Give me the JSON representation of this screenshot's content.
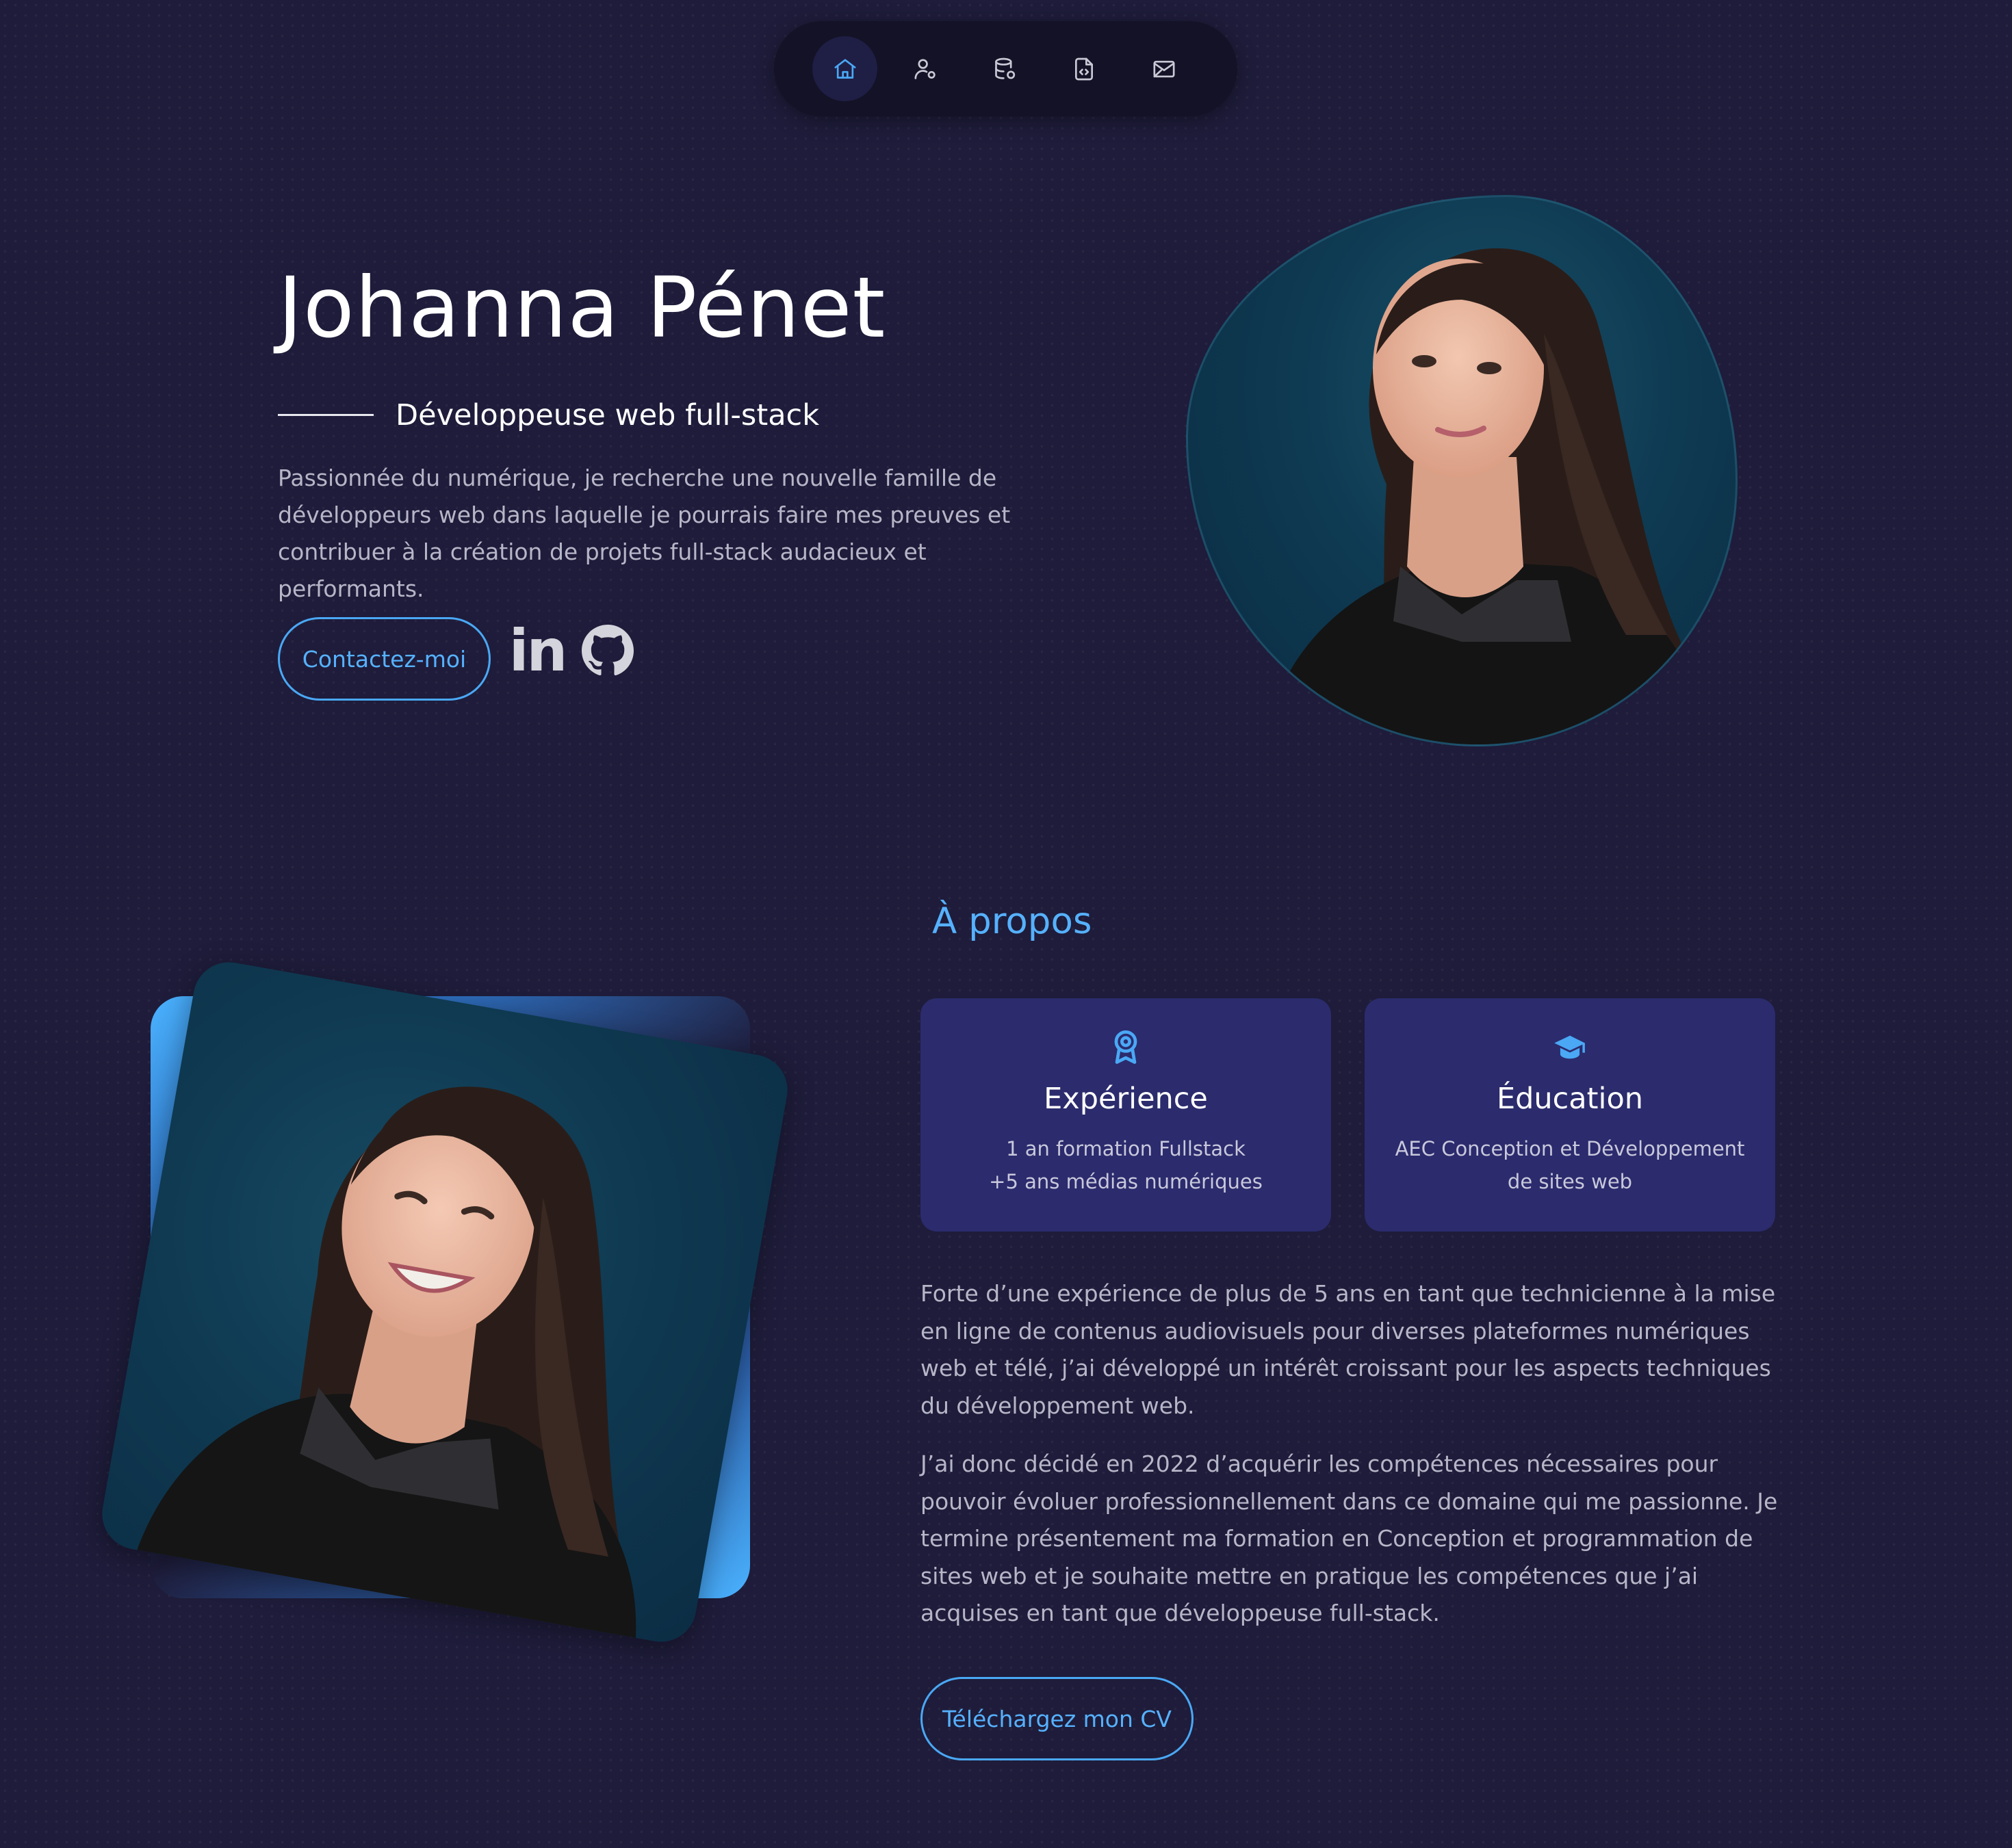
{
  "nav": {
    "items": [
      {
        "icon": "home-icon",
        "active": true
      },
      {
        "icon": "user-icon",
        "active": false
      },
      {
        "icon": "database-icon",
        "active": false
      },
      {
        "icon": "code-file-icon",
        "active": false
      },
      {
        "icon": "mail-icon",
        "active": false
      }
    ]
  },
  "hero": {
    "name": "Johanna Pénet",
    "subtitle": "Développeuse web full-stack",
    "description": "Passionnée du numérique, je recherche une nouvelle famille de développeurs web dans laquelle je pourrais faire mes preuves et contribuer à la création de projets full-stack audacieux et performants.",
    "contact_button": "Contactez-moi",
    "linkedin_label": "in",
    "social_icons": [
      "linkedin-icon",
      "github-icon"
    ]
  },
  "about": {
    "title": "À propos",
    "experience": {
      "icon": "award-icon",
      "title": "Expérience",
      "line1": "1 an formation Fullstack",
      "line2": "+5 ans médias numériques"
    },
    "education": {
      "icon": "graduation-cap-icon",
      "title": "Éducation",
      "line1": "AEC Conception et Développement",
      "line2": "de sites web"
    },
    "paragraph1": "Forte d’une expérience de plus de 5 ans en tant que technicienne à la mise en ligne de contenus audiovisuels pour diverses plateformes numériques web et télé, j’ai développé un intérêt croissant pour les aspects techniques du développement web.",
    "paragraph2": "J’ai donc décidé en 2022 d’acquérir les compétences nécessaires pour pouvoir évoluer professionnellement dans ce domaine qui me passionne. Je termine présentement ma formation en Conception et programmation de sites web et je souhaite mettre en pratique les compétences que j’ai acquises en tant que développeuse full-stack.",
    "cv_button": "Téléchargez mon CV"
  },
  "colors": {
    "background": "#1e1c3a",
    "accent": "#56b1ff",
    "card": "#2b2b6d",
    "nav": "#141226"
  }
}
